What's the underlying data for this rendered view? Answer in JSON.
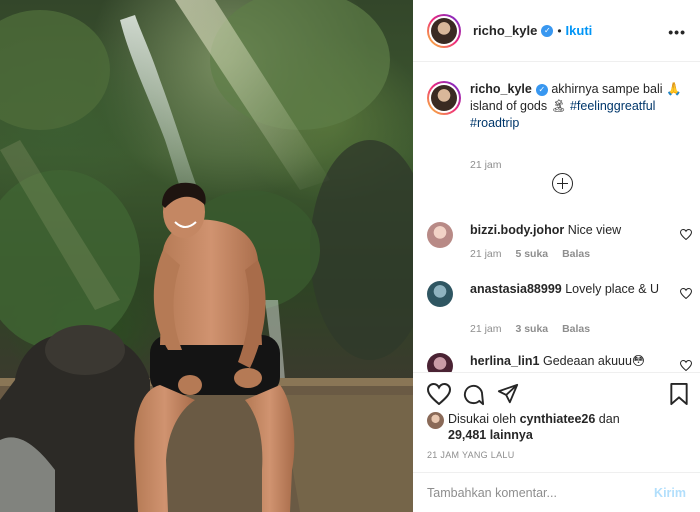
{
  "post": {
    "username": "richo_kyle",
    "follow_label": "Ikuti",
    "more_label": "•••"
  },
  "caption": {
    "username": "richo_kyle",
    "text_a": "akhirnya sampe bali 🙏",
    "text_b": "island of gods 🏝",
    "hashtag1": "#feelinggreatful",
    "hashtag2": "#roadtrip",
    "time": "21 jam"
  },
  "comments": [
    {
      "user": "bizzi.body.johor",
      "text": "Nice view",
      "time": "21 jam",
      "likes": "5 suka",
      "reply": "Balas",
      "avatar_color": "#d9a7a2"
    },
    {
      "user": "anastasia88999",
      "text": "Lovely place & U",
      "time": "21 jam",
      "likes": "3 suka",
      "reply": "Balas",
      "avatar_color": "#3e6a7a"
    },
    {
      "user": "herlina_lin1",
      "text": "Gedeaan akuuu😳",
      "time": "",
      "likes": "",
      "reply": "",
      "avatar_color": "#5a2f40"
    }
  ],
  "likes": {
    "prefix": "Disukai oleh",
    "user": "cynthiatee26",
    "conj": "dan",
    "count": "29,481 lainnya"
  },
  "posted_ago": "21 JAM YANG LALU",
  "add_comment": {
    "placeholder": "Tambahkan komentar...",
    "send_label": "Kirim"
  },
  "icons": [
    "heart-icon",
    "comment-icon",
    "share-icon",
    "bookmark-icon",
    "add-icon",
    "verified-badge-icon"
  ],
  "colors": {
    "accent": "#0095f6",
    "hashtag": "#00376b",
    "muted": "#8e8e8e"
  }
}
